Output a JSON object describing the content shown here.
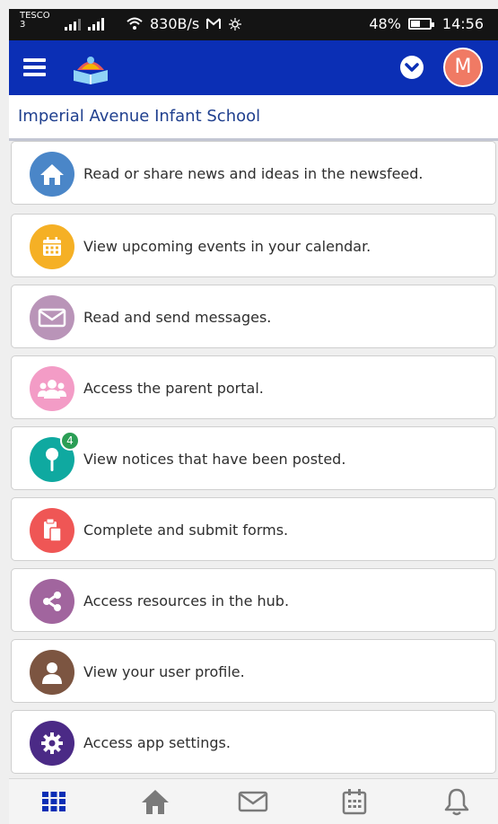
{
  "status_bar": {
    "carrier": "TESCO",
    "carrier_sub": "3",
    "network_speed": "830B/s",
    "battery": "48%",
    "time": "14:56"
  },
  "header": {
    "avatar_initial": "M"
  },
  "school_name": "Imperial Avenue Infant School",
  "menu": [
    {
      "label": "Read or share news and ideas in the newsfeed.",
      "icon": "home-icon",
      "color": "#4a86c8"
    },
    {
      "label": "View upcoming events in your calendar.",
      "icon": "calendar-icon",
      "color": "#f5b025"
    },
    {
      "label": "Read and send messages.",
      "icon": "mail-icon",
      "color": "#b994b8"
    },
    {
      "label": "Access the parent portal.",
      "icon": "group-icon",
      "color": "#f39cc6"
    },
    {
      "label": "View notices that have been posted.",
      "icon": "pin-icon",
      "color": "#0fa9a0",
      "badge": "4"
    },
    {
      "label": "Complete and submit forms.",
      "icon": "clipboard-icon",
      "color": "#ef5655"
    },
    {
      "label": "Access resources in the hub.",
      "icon": "share-icon",
      "color": "#a1659e"
    },
    {
      "label": "View your user profile.",
      "icon": "user-icon",
      "color": "#7c5541"
    },
    {
      "label": "Access app settings.",
      "icon": "gear-icon",
      "color": "#4b2a86"
    }
  ],
  "bottom_nav": [
    {
      "icon": "grid-icon",
      "active": true
    },
    {
      "icon": "home-icon"
    },
    {
      "icon": "mail-icon"
    },
    {
      "icon": "calendar-icon"
    },
    {
      "icon": "bell-icon"
    }
  ]
}
